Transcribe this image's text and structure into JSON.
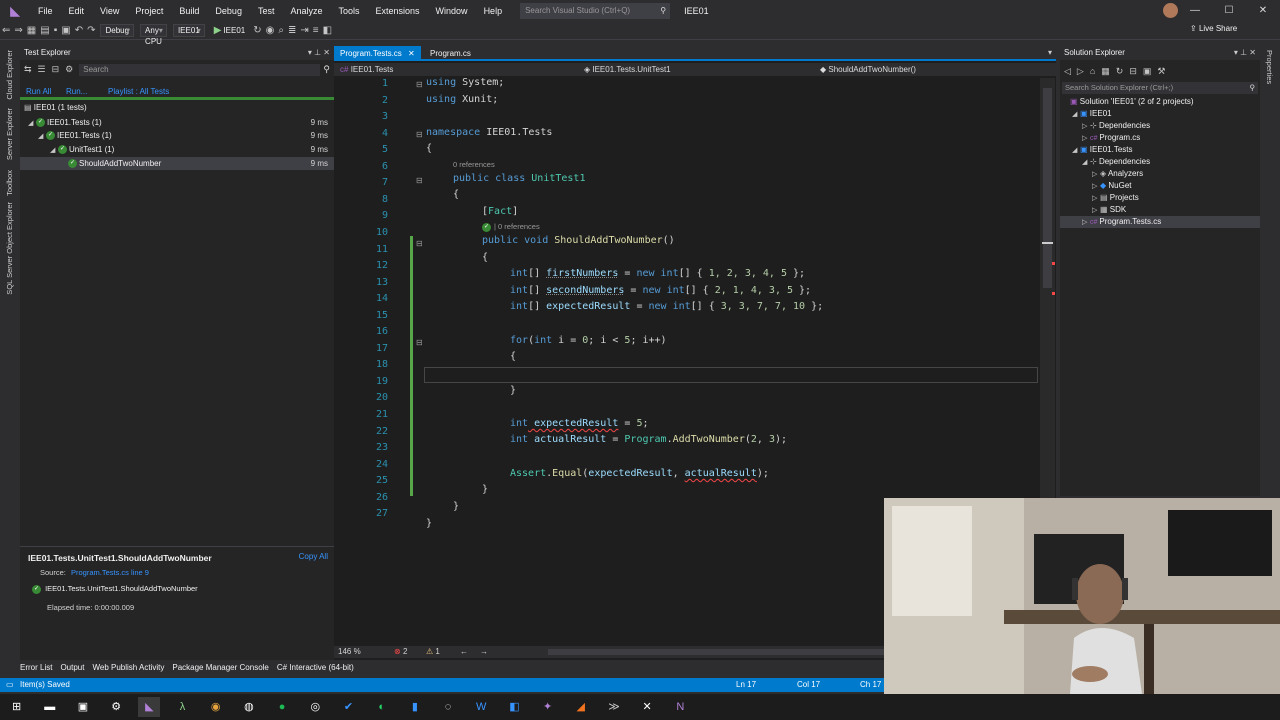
{
  "menu": [
    "File",
    "Edit",
    "View",
    "Project",
    "Build",
    "Debug",
    "Test",
    "Analyze",
    "Tools",
    "Extensions",
    "Window",
    "Help"
  ],
  "search_placeholder": "Search Visual Studio (Ctrl+Q)",
  "solution_name": "IEE01",
  "live_share": "Live Share",
  "toolbar": {
    "config": "Debug",
    "platform": "Any CPU",
    "startup": "IEE01",
    "run_target": "IEE01"
  },
  "test_explorer": {
    "title": "Test Explorer",
    "search_placeholder": "Search",
    "run_all": "Run All",
    "run": "Run...",
    "playlist": "Playlist : All Tests",
    "tree": [
      {
        "label": "IEE01 (1 tests)",
        "time": ""
      },
      {
        "label": "IEE01.Tests (1)",
        "time": "9 ms"
      },
      {
        "label": "IEE01.Tests (1)",
        "time": "9 ms"
      },
      {
        "label": "UnitTest1 (1)",
        "time": "9 ms"
      },
      {
        "label": "ShouldAddTwoNumber",
        "time": "9 ms"
      }
    ],
    "detail": {
      "name": "IEE01.Tests.UnitTest1.ShouldAddTwoNumber",
      "copy_all": "Copy All",
      "source_label": "Source:",
      "source_link": "Program.Tests.cs line 9",
      "result_name": "IEE01.Tests.UnitTest1.ShouldAddTwoNumber",
      "elapsed": "Elapsed time: 0:00:00.009"
    }
  },
  "editor": {
    "tabs": [
      "Program.Tests.cs",
      "Program.cs"
    ],
    "nav_project": "IEE01.Tests",
    "nav_class": "IEE01.Tests.UnitTest1",
    "nav_member": "ShouldAddTwoNumber()",
    "zoom": "146 %",
    "errors": "2",
    "warnings": "1",
    "line_numbers": [
      "1",
      "2",
      "3",
      "4",
      "5",
      "6",
      "7",
      "8",
      "9",
      "10",
      "11",
      "12",
      "13",
      "14",
      "15",
      "16",
      "17",
      "18",
      "19",
      "20",
      "21",
      "22",
      "23",
      "24",
      "25",
      "26",
      "27"
    ],
    "refs_class": "0 references",
    "refs_method": "| 0 references",
    "code": {
      "l1_kw": "using",
      "l1_rest": " System;",
      "l2_kw": "using",
      "l2_rest": " Xunit;",
      "l4_kw": "namespace",
      "l4_rest": " IEE01.Tests",
      "l5": "{",
      "l6_kw": "public class",
      "l6_ty": "UnitTest1",
      "l7": "{",
      "l8_open": "[",
      "l8_attr": "Fact",
      "l8_close": "]",
      "l9_kw": "public void",
      "l9_fn": "ShouldAddTwoNumber",
      "l9_rest": "()",
      "l10": "{",
      "l11_kw": "int",
      "l11_a": "[] ",
      "l11_var": "firstNumbers",
      "l11_b": " = ",
      "l11_new": "new",
      "l11_int": "int",
      "l11_c": "[] { ",
      "l11_vals": "1, 2, 3, 4, 5",
      "l11_d": " };",
      "l12_kw": "int",
      "l12_a": "[] ",
      "l12_var": "secondNumbers",
      "l12_b": " = ",
      "l12_new": "new",
      "l12_int": "int",
      "l12_c": "[] { ",
      "l12_vals": "2, 1, 4, 3, 5",
      "l12_d": " };",
      "l13_kw": "int",
      "l13_a": "[] ",
      "l13_var": "expectedResult",
      "l13_b": " = ",
      "l13_new": "new",
      "l13_int": "int",
      "l13_c": "[] { ",
      "l13_vals": "3, 3, 7, 7, 10",
      "l13_d": " };",
      "l15_kw": "for",
      "l15_a": "(",
      "l15_int": "int",
      "l15_b": " i = ",
      "l15_n0": "0",
      "l15_c": "; i < ",
      "l15_n5": "5",
      "l15_d": "; i++)",
      "l16": "{",
      "l18": "}",
      "l20_kw": "int",
      "l20_var": " expectedResult",
      "l20_a": " = ",
      "l20_n": "5",
      "l20_b": ";",
      "l21_kw": "int",
      "l21_var": " actualResult",
      "l21_a": " = ",
      "l21_ty": "Program",
      "l21_b": ".",
      "l21_fn": "AddTwoNumber",
      "l21_c": "(",
      "l21_n1": "2",
      "l21_d": ", ",
      "l21_n2": "3",
      "l21_e": ");",
      "l23_ty": "Assert",
      "l23_a": ".",
      "l23_fn": "Equal",
      "l23_b": "(",
      "l23_v1": "expectedResult",
      "l23_c": ", ",
      "l23_v2": "actualResult",
      "l23_d": ");",
      "l24": "}",
      "l25": "}",
      "l26": "}"
    }
  },
  "solution_explorer": {
    "title": "Solution Explorer",
    "search_placeholder": "Search Solution Explorer (Ctrl+;)",
    "items": [
      "Solution 'IEE01' (2 of 2 projects)",
      "IEE01",
      "Dependencies",
      "Program.cs",
      "IEE01.Tests",
      "Dependencies",
      "Analyzers",
      "NuGet",
      "Projects",
      "SDK",
      "Program.Tests.cs"
    ]
  },
  "left_strip": [
    "Cloud Explorer",
    "Server Explorer",
    "Toolbox",
    "SQL Server Object Explorer"
  ],
  "right_strip": [
    "Properties"
  ],
  "bottom_tabs": [
    "Error List",
    "Output",
    "Web Publish Activity",
    "Package Manager Console",
    "C# Interactive (64-bit)"
  ],
  "status": {
    "message": "Item(s) Saved",
    "line": "Ln 17",
    "col": "Col 17",
    "ch": "Ch 17"
  },
  "colors": {
    "accent": "#007acc",
    "pass": "#388a34",
    "error": "#f44747"
  }
}
